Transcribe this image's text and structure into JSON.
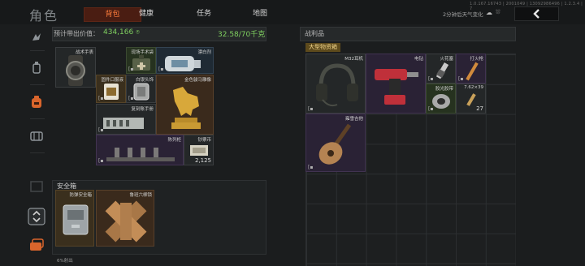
{
  "header": {
    "title": "角色",
    "tabs": [
      {
        "label": "背包",
        "active": true
      },
      {
        "label": "健康",
        "active": false
      },
      {
        "label": "任务",
        "active": false
      },
      {
        "label": "地图",
        "active": false
      }
    ],
    "version": "1.0.167.16743 | 2001049 | 13092986496 | 1.2.3.4 | 7",
    "weather_text": "2分钟后天气变化",
    "weather_icons": [
      "cloud-icon",
      "rain-icon"
    ],
    "back_icon": "chevron-left-icon"
  },
  "sidebar": {
    "icons": [
      "character-icon",
      "equipment-icon",
      "backpack-icon",
      "chest-rig-icon",
      "safe-box-icon",
      "swap-icon",
      "cards-icon"
    ],
    "active_index": 2
  },
  "inventory": {
    "value_label": "预计带出价值：",
    "value_amount": "434,166",
    "weight": "32.58/70千克",
    "items": [
      {
        "label": "战术手表",
        "tier": "gray",
        "icon": "watch-icon"
      },
      {
        "label": "现场手术袋",
        "tier": "green",
        "icon": "surgery-bag-icon"
      },
      {
        "label": "漂白剂",
        "tier": "blue",
        "icon": "bleach-icon"
      },
      {
        "label": "固件口服液",
        "tier": "gold",
        "icon": "oral-liquid-icon"
      },
      {
        "label": "白银头饰",
        "tier": "gray",
        "icon": "silver-icon"
      },
      {
        "label": "金色骏马雕像",
        "tier": "brown",
        "icon": "horse-statue-icon"
      },
      {
        "label": "复刻账手册",
        "tier": "gray",
        "icon": "ledger-icon"
      },
      {
        "label": "陈列柜",
        "tier": "purple",
        "icon": "rack-icon"
      },
      {
        "label": "钞票币",
        "tier": "gray",
        "icon": "banknote-icon",
        "count": "2,125"
      }
    ]
  },
  "safe": {
    "title": "安全箱",
    "items": [
      {
        "label": "防弹安全箱",
        "tier": "gold",
        "icon": "safe-case-icon"
      },
      {
        "label": "鲁班六柳锁",
        "tier": "brown",
        "icon": "wooden-puzzle-icon"
      }
    ],
    "footer": "6%射出"
  },
  "loot": {
    "title": "战利品",
    "container": "大型物资箱",
    "items": [
      {
        "label": "M32耳机",
        "tier": "gray",
        "icon": "headset-icon"
      },
      {
        "label": "电钻",
        "tier": "purple",
        "icon": "drill-icon"
      },
      {
        "label": "火花塞",
        "tier": "gray",
        "icon": "spark-plug-icon"
      },
      {
        "label": "打火枪",
        "tier": "purple",
        "icon": "lighter-icon"
      },
      {
        "label": "胶光胶带",
        "tier": "green",
        "icon": "tape-icon"
      },
      {
        "label": "7.62×39",
        "tier": "gray",
        "icon": "ammo-icon",
        "count": "27"
      },
      {
        "label": "雍雪吉他",
        "tier": "purple",
        "icon": "guitar-icon"
      }
    ]
  },
  "colors": {
    "accent": "#ff7d3c",
    "value_green": "#7fcf5f",
    "crate_tag": "#5d4a1c"
  }
}
